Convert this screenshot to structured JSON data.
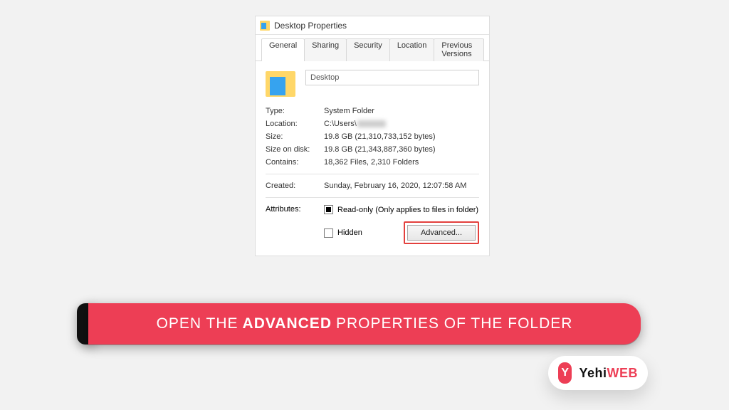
{
  "window": {
    "title": "Desktop Properties",
    "tabs": [
      "General",
      "Sharing",
      "Security",
      "Location",
      "Previous Versions"
    ],
    "active_tab": 0,
    "folder_name": "Desktop",
    "fields": {
      "type_label": "Type:",
      "type_value": "System Folder",
      "location_label": "Location:",
      "location_value": "C:\\Users\\",
      "size_label": "Size:",
      "size_value": "19.8 GB (21,310,733,152 bytes)",
      "sizeondisk_label": "Size on disk:",
      "sizeondisk_value": "19.8 GB (21,343,887,360 bytes)",
      "contains_label": "Contains:",
      "contains_value": "18,362 Files, 2,310 Folders",
      "created_label": "Created:",
      "created_value": "Sunday, February 16, 2020, 12:07:58 AM"
    },
    "attributes": {
      "label": "Attributes:",
      "readonly_label": "Read-only (Only applies to files in folder)",
      "readonly_state": "indeterminate",
      "hidden_label": "Hidden",
      "hidden_state": "unchecked",
      "advanced_button": "Advanced..."
    }
  },
  "banner": {
    "pre": "OPEN THE",
    "bold": "ADVANCED",
    "post": "PROPERTIES OF THE FOLDER"
  },
  "logo": {
    "mark": "Y",
    "brand_a": "Yehi",
    "brand_b": "WEB"
  }
}
